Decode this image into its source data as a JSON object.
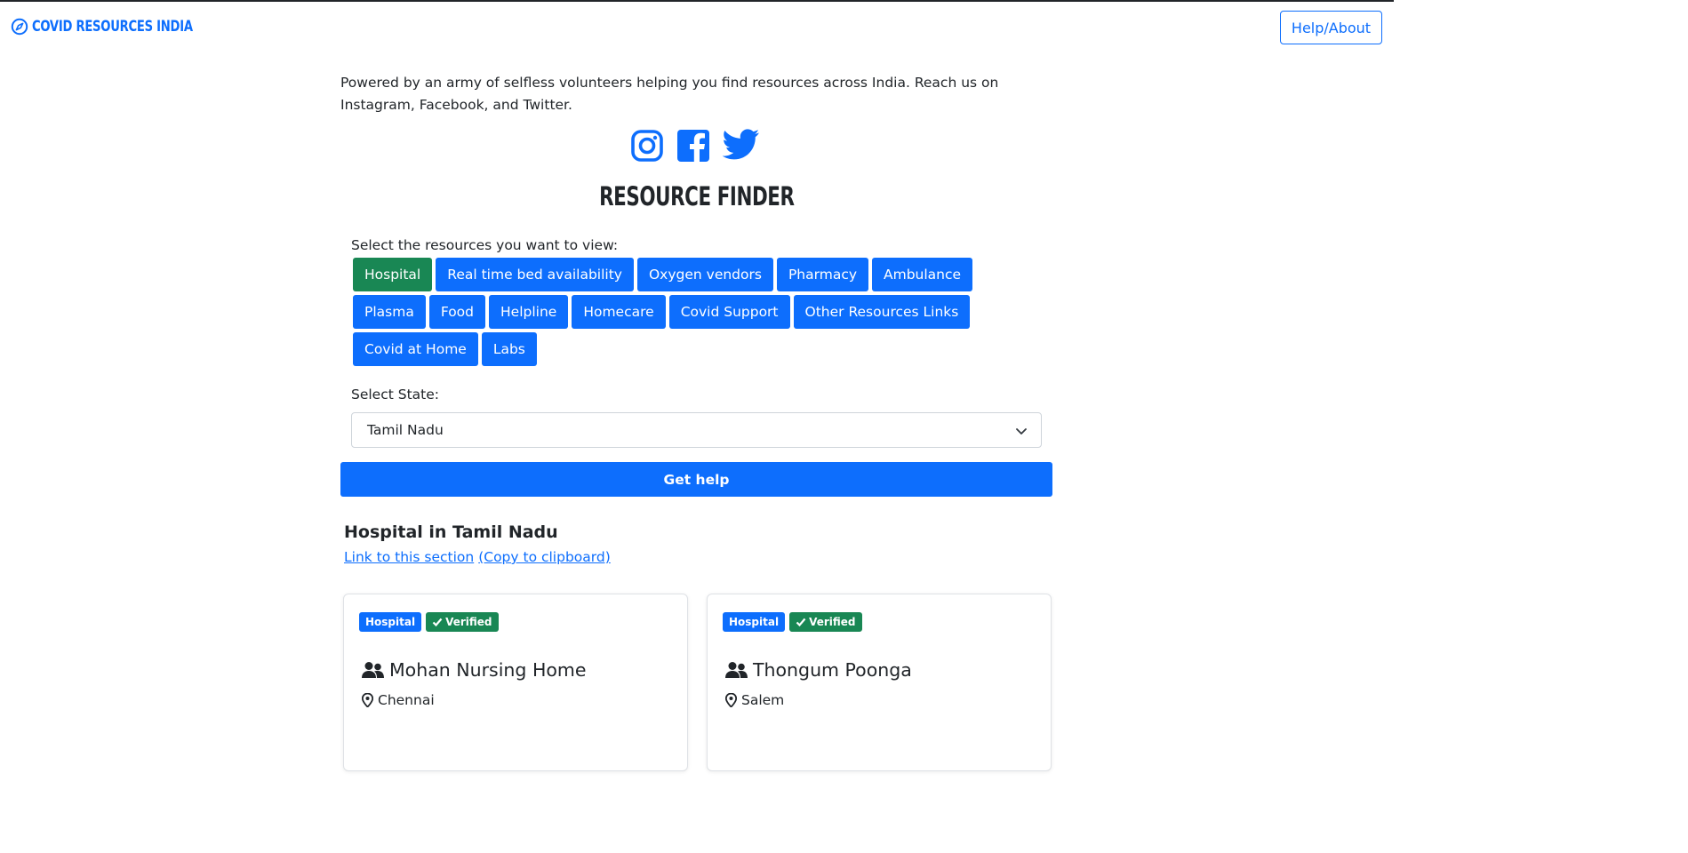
{
  "header": {
    "brand": "Covid Resources India",
    "help_label": "Help/About"
  },
  "intro": {
    "text": "Powered by an army of selfless volunteers helping you find resources across India. Reach us on Instagram, Facebook, and Twitter."
  },
  "socials": [
    "instagram-icon",
    "facebook-icon",
    "twitter-icon"
  ],
  "finder": {
    "title": "Resource Finder",
    "resources_label": "Select the resources you want to view:",
    "resources": [
      {
        "label": "Hospital",
        "selected": true
      },
      {
        "label": "Real time bed availability",
        "selected": false
      },
      {
        "label": "Oxygen vendors",
        "selected": false
      },
      {
        "label": "Pharmacy",
        "selected": false
      },
      {
        "label": "Ambulance",
        "selected": false
      },
      {
        "label": "Plasma",
        "selected": false
      },
      {
        "label": "Food",
        "selected": false
      },
      {
        "label": "Helpline",
        "selected": false
      },
      {
        "label": "Homecare",
        "selected": false
      },
      {
        "label": "Covid Support",
        "selected": false
      },
      {
        "label": "Other Resources Links",
        "selected": false
      },
      {
        "label": "Covid at Home",
        "selected": false
      },
      {
        "label": "Labs",
        "selected": false
      }
    ],
    "state_label": "Select State:",
    "state_value": "Tamil Nadu",
    "submit_label": "Get help"
  },
  "results": {
    "title": "Hospital in Tamil Nadu",
    "link_label": "Link to this section",
    "copy_label": "(Copy to clipboard)",
    "cards": [
      {
        "type_badge": "Hospital",
        "status_badge": "Verified",
        "name": "Mohan Nursing Home",
        "city": "Chennai"
      },
      {
        "type_badge": "Hospital",
        "status_badge": "Verified",
        "name": "Thongum Poonga",
        "city": "Salem"
      }
    ]
  },
  "colors": {
    "primary": "#0d6efd",
    "success": "#198754",
    "text": "#212529"
  }
}
